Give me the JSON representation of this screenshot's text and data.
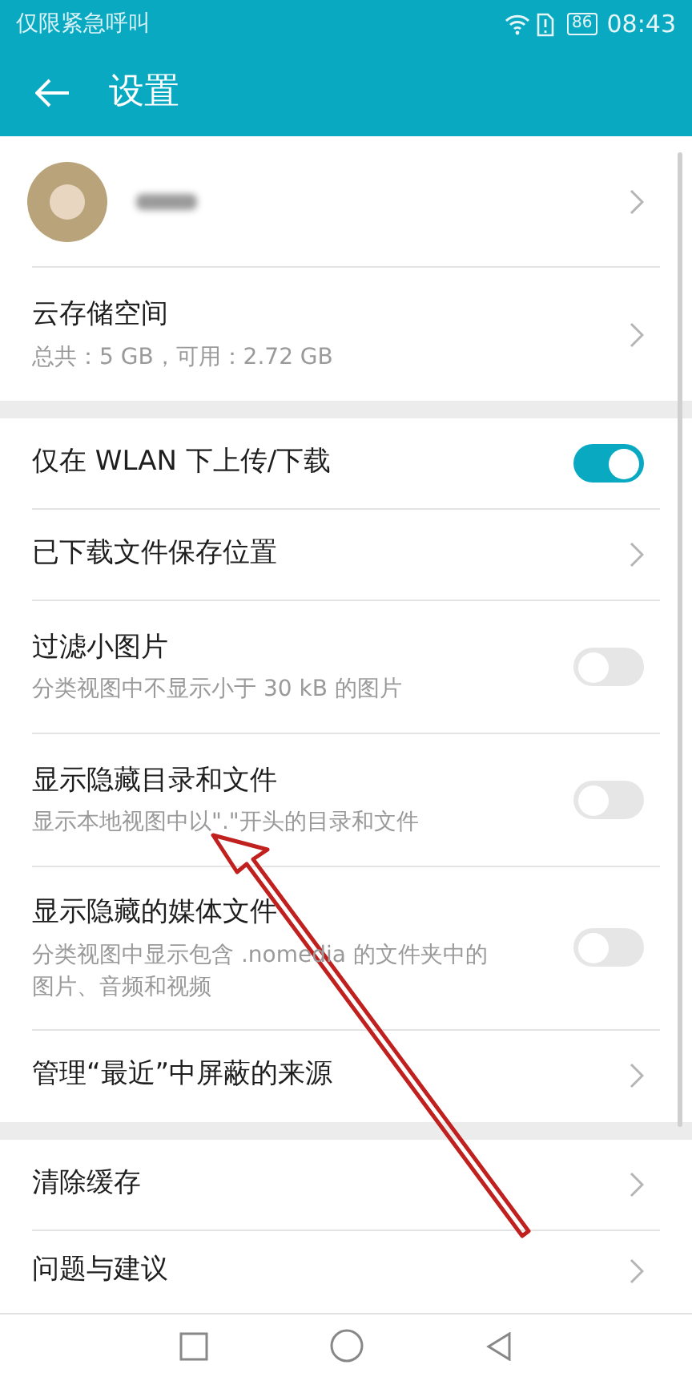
{
  "status_bar": {
    "carrier": "仅限紧急呼叫",
    "battery": "86",
    "time": "08:43"
  },
  "header": {
    "title": "设置"
  },
  "sections": [
    {
      "rows": [
        {
          "kind": "profile"
        },
        {
          "kind": "link",
          "title": "云存储空间",
          "subtitle": "总共：5 GB，可用：2.72 GB"
        }
      ]
    },
    {
      "rows": [
        {
          "kind": "toggle",
          "title": "仅在 WLAN 下上传/下载",
          "on": true
        },
        {
          "kind": "link",
          "title": "已下载文件保存位置"
        },
        {
          "kind": "toggle",
          "title": "过滤小图片",
          "subtitle": "分类视图中不显示小于 30 kB 的图片",
          "on": false
        },
        {
          "kind": "toggle",
          "title": "显示隐藏目录和文件",
          "subtitle": "显示本地视图中以\".\"开头的目录和文件",
          "on": false
        },
        {
          "kind": "toggle",
          "title": "显示隐藏的媒体文件",
          "subtitle": "分类视图中显示包含 .nomedia 的文件夹中的图片、音频和视频",
          "on": false
        },
        {
          "kind": "link",
          "title": "管理“最近”中屏蔽的来源"
        }
      ]
    },
    {
      "rows": [
        {
          "kind": "link",
          "title": "清除缓存"
        },
        {
          "kind": "link",
          "title": "问题与建议"
        }
      ]
    }
  ]
}
